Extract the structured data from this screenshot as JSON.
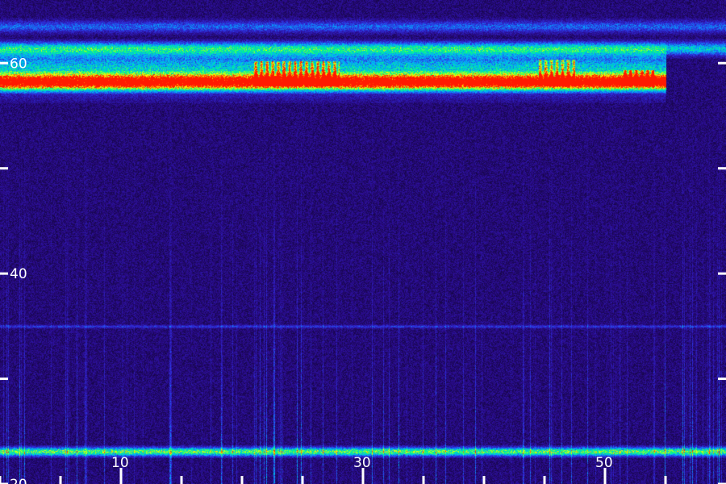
{
  "chart_data": {
    "type": "heatmap",
    "title": "",
    "xlabel": "",
    "ylabel": "",
    "x_tick_labels": [
      "10",
      "30",
      "50"
    ],
    "x_tick_values": [
      10,
      30,
      50
    ],
    "x_minor_tick_values": [
      0,
      5,
      15,
      20,
      25,
      35,
      40,
      45,
      55
    ],
    "xlim": [
      0,
      60
    ],
    "y_tick_labels": [
      "20",
      "40",
      "60"
    ],
    "y_tick_values": [
      20,
      40,
      60
    ],
    "y_minor_tick_values": [
      30,
      50
    ],
    "ylim": [
      20,
      66
    ],
    "colormap": [
      "#0a0420",
      "#2a0a88",
      "#2f2fe0",
      "#00b0ff",
      "#00ff80",
      "#ffff00",
      "#ff1a00"
    ],
    "background_color": "#12062e",
    "bands": [
      {
        "y_center": 63.5,
        "thickness": 0.7,
        "intensity": 0.28,
        "x_range": [
          0,
          60
        ],
        "note_free": true
      },
      {
        "y_center": 61.4,
        "thickness": 0.8,
        "intensity": 0.45,
        "x_range": [
          0,
          60
        ],
        "note_free": true
      },
      {
        "y_center": 58.2,
        "thickness": 0.9,
        "intensity": 0.92,
        "x_range": [
          0,
          55
        ],
        "note_free": true
      },
      {
        "y_center": 59.2,
        "thickness": 2.6,
        "intensity": 0.48,
        "x_range": [
          0,
          55
        ],
        "note_free": true
      },
      {
        "y_center": 35.0,
        "thickness": 0.12,
        "intensity": 0.2,
        "x_range": [
          0,
          60
        ],
        "note_free": true
      },
      {
        "y_center": 23.1,
        "thickness": 0.5,
        "intensity": 0.62,
        "x_range": [
          0,
          60
        ],
        "note_free": true
      }
    ],
    "bursts": [
      {
        "x_range": [
          21,
          28
        ],
        "y_range": [
          57.8,
          60.2
        ],
        "intensity": 0.75
      },
      {
        "x_range": [
          44.5,
          47.5
        ],
        "y_range": [
          57.8,
          60.4
        ],
        "intensity": 0.62
      },
      {
        "x_range": [
          51.5,
          54
        ],
        "y_range": [
          57.8,
          59.4
        ],
        "intensity": 0.8
      }
    ]
  }
}
